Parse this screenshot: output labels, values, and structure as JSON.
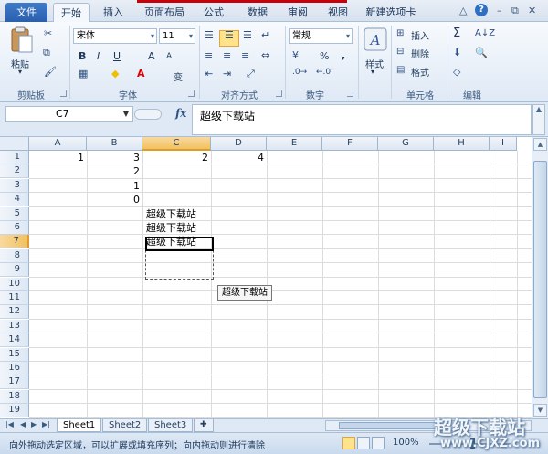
{
  "tabs": {
    "file": "文件",
    "items": [
      "开始",
      "插入",
      "页面布局",
      "公式",
      "数据",
      "审阅",
      "视图",
      "新建选项卡"
    ],
    "active_index": 0
  },
  "window_controls": {
    "minimize_ribbon": "△",
    "help": "?",
    "minimize": "–",
    "restore": "⧉",
    "close": "✕"
  },
  "ribbon": {
    "clipboard": {
      "label": "剪贴板",
      "paste": "粘贴"
    },
    "font": {
      "label": "字体",
      "name": "宋体",
      "size": "11",
      "bold": "B",
      "italic": "I",
      "underline": "U",
      "grow": "A",
      "shrink": "A",
      "wen": "变"
    },
    "alignment": {
      "label": "对齐方式"
    },
    "number": {
      "label": "数字",
      "format": "常规",
      "percent": "%",
      "comma": ","
    },
    "styles": {
      "label": "样式"
    },
    "cells": {
      "label": "单元格",
      "insert": "插入",
      "delete": "删除",
      "format": "格式"
    },
    "editing": {
      "label": "编辑",
      "sum": "Σ"
    }
  },
  "formula_bar": {
    "name_box": "C7",
    "fx": "fx",
    "value": "超级下载站"
  },
  "grid": {
    "columns": [
      "A",
      "B",
      "C",
      "D",
      "E",
      "F",
      "G",
      "H",
      "I"
    ],
    "selected_column": "C",
    "rows": [
      "1",
      "2",
      "3",
      "4",
      "5",
      "6",
      "7",
      "8",
      "9",
      "10",
      "11",
      "12",
      "13",
      "14",
      "15",
      "16",
      "17",
      "18",
      "19"
    ],
    "selected_row": "7",
    "cells": {
      "A1": "1",
      "B1": "3",
      "C1": "2",
      "D1": "4",
      "B2": "2",
      "B3": "1",
      "B4": "0",
      "C5": "超级下载站",
      "C6": "超级下载站",
      "C7": "超级下载站"
    },
    "fill_tooltip": "超级下载站"
  },
  "sheets": {
    "tabs": [
      "Sheet1",
      "Sheet2",
      "Sheet3"
    ],
    "active_index": 0
  },
  "status": {
    "message": "向外拖动选定区域，可以扩展或填充序列；向内拖动则进行清除",
    "zoom": "100%"
  },
  "watermark": {
    "title": "超级下载站",
    "url": "www.CJXZ.com"
  }
}
